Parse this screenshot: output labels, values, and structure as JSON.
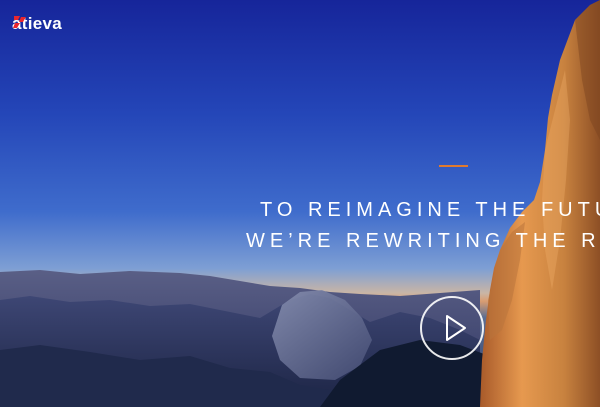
{
  "brand": {
    "name": "atieva",
    "logo_icon": "atieva-logo-icon",
    "logo_color": "#e8262f"
  },
  "hero": {
    "accent_color": "#e07a2e",
    "headline_line_1": "TO REIMAGINE THE FUTU",
    "headline_line_2": "WE’RE REWRITING THE RU",
    "play_icon": "play-icon"
  }
}
